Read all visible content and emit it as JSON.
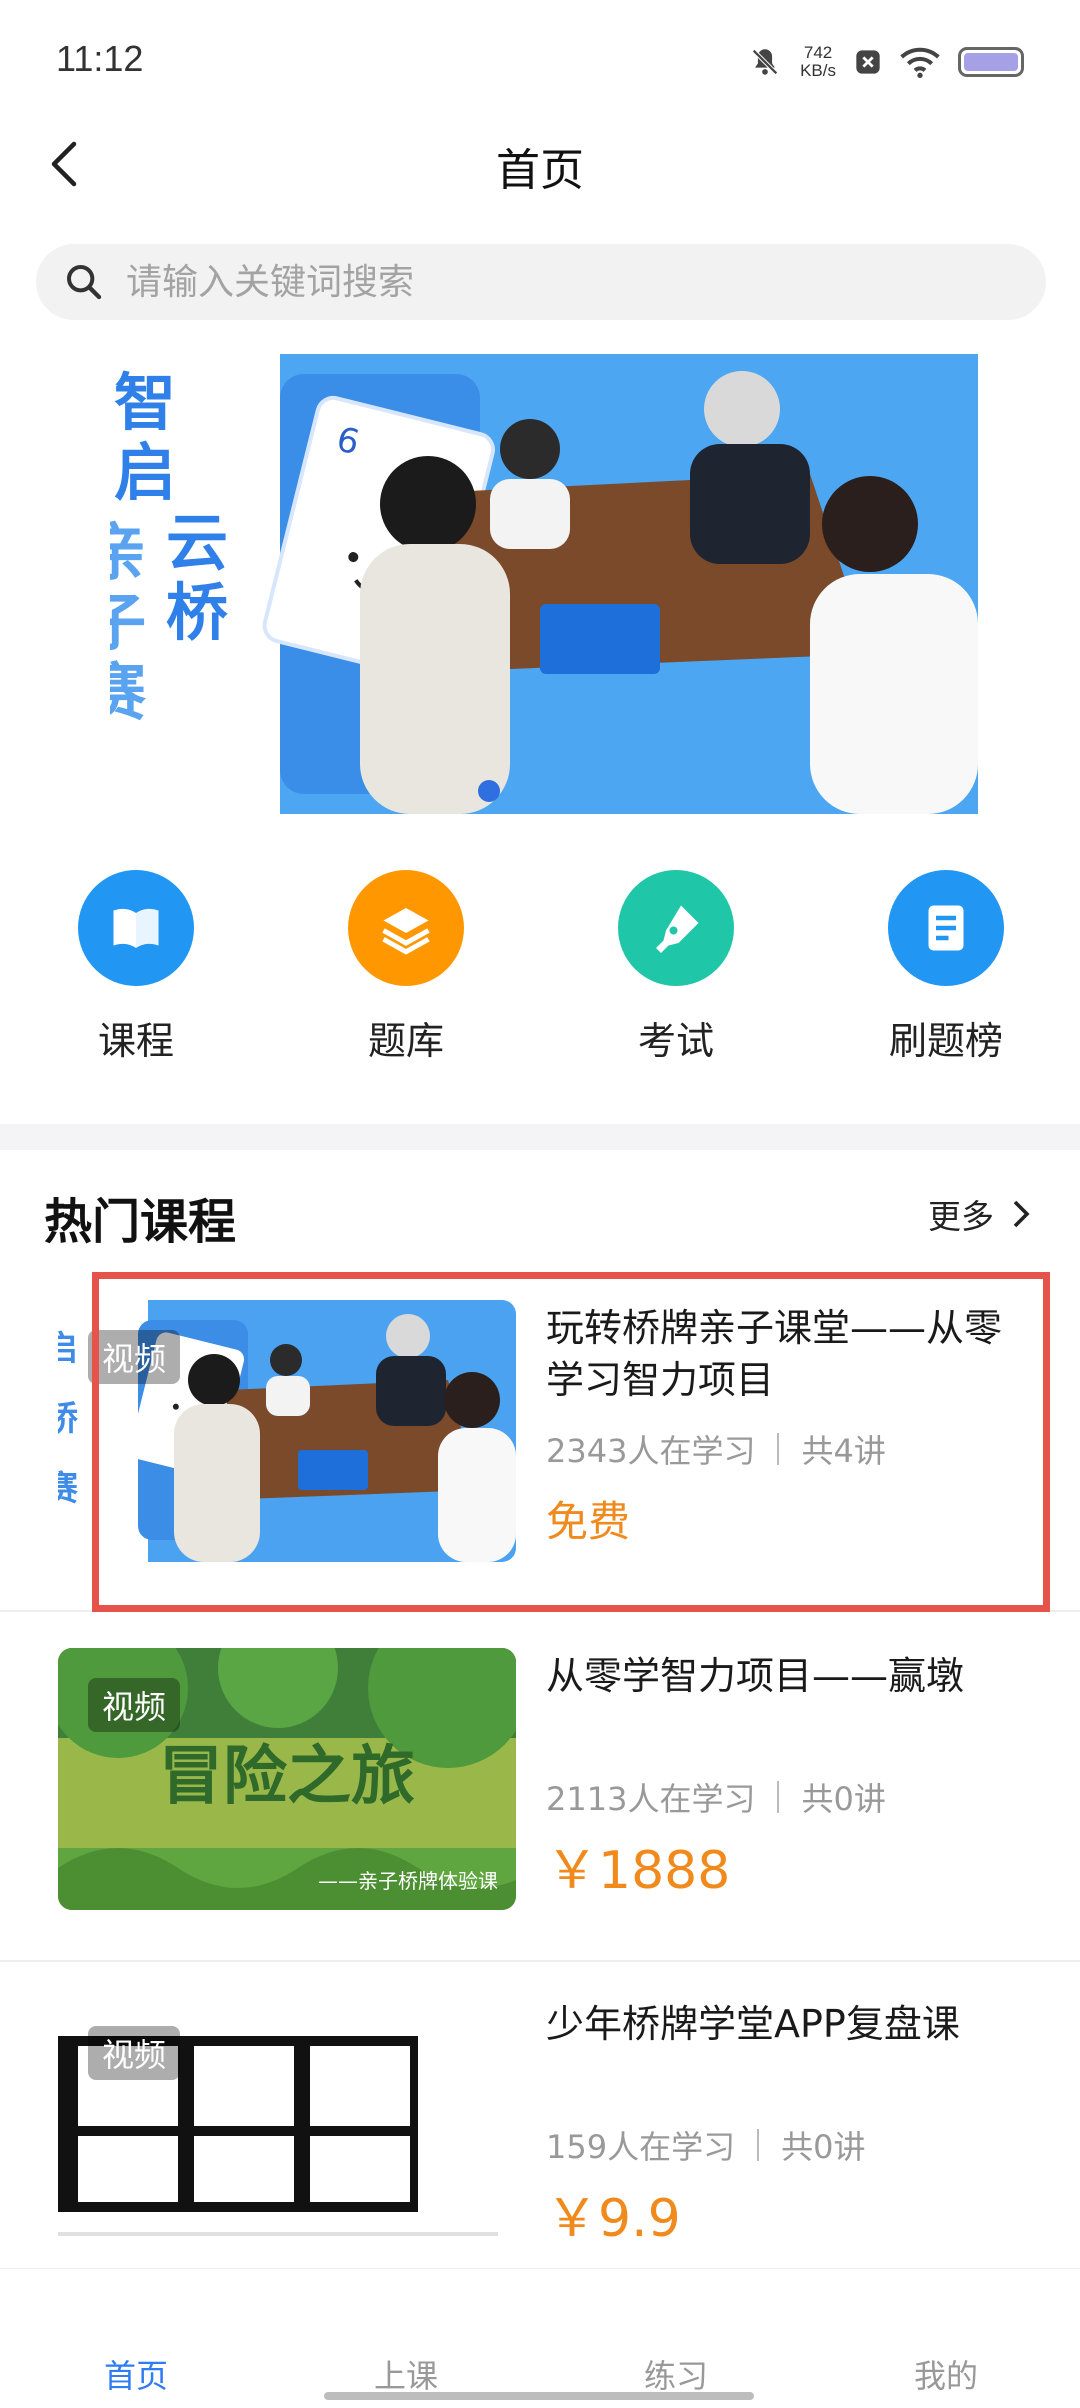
{
  "status_bar": {
    "time": "11:12",
    "speed_value": "742",
    "speed_unit": "KB/s"
  },
  "nav": {
    "title": "首页"
  },
  "search": {
    "placeholder": "请输入关键词搜索"
  },
  "banner": {
    "vertical_text": "智启云桥 亲子赛"
  },
  "quick_menu": [
    {
      "label": "课程",
      "icon": "book-icon",
      "color": "#2196f3"
    },
    {
      "label": "题库",
      "icon": "layers-icon",
      "color": "#ff9800"
    },
    {
      "label": "考试",
      "icon": "pen-icon",
      "color": "#1fc7a8"
    },
    {
      "label": "刷题榜",
      "icon": "list-icon",
      "color": "#2196f3"
    }
  ],
  "hot": {
    "title": "热门课程",
    "more": "更多",
    "courses": [
      {
        "tag": "视频",
        "title": "玩转桥牌亲子课堂——从零学习智力项目",
        "learners": "2343人在学习",
        "lectures": "共4讲",
        "price": "免费"
      },
      {
        "tag": "视频",
        "title": "从零学智力项目——赢墩",
        "learners": "2113人在学习",
        "lectures": "共0讲",
        "price": "￥1888",
        "thumb_title": "冒险之旅",
        "thumb_subtitle": "——亲子桥牌体验课"
      },
      {
        "tag": "视频",
        "title": "少年桥牌学堂APP复盘课",
        "learners": "159人在学习",
        "lectures": "共0讲",
        "price": "￥9.9"
      }
    ]
  },
  "tabs": [
    "首页",
    "上课",
    "练习",
    "我的"
  ],
  "colors": {
    "accent": "#2f7cf6",
    "price": "#f08a1c",
    "highlight": "#e5534b"
  }
}
